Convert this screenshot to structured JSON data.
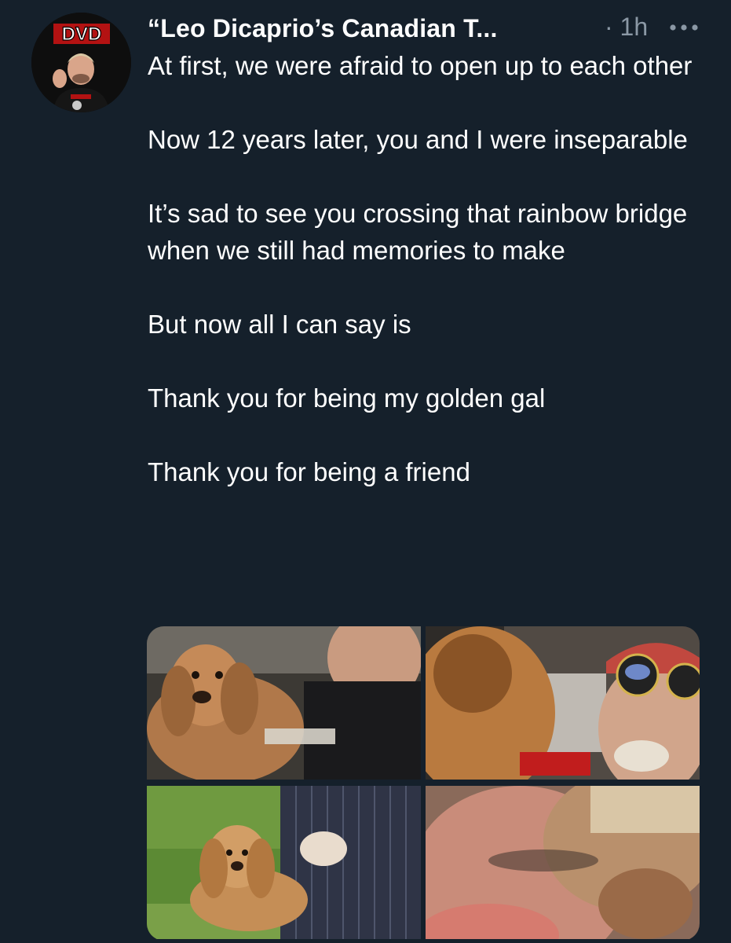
{
  "tweet": {
    "display_name": "“Leo Dicaprio’s Canadian T...",
    "timestamp": "· 1h",
    "body": "At first, we were afraid to open up to each other\n\nNow 12 years later, you and I were inseparable\n\nIt’s sad to see you crossing that rainbow bridge when we still had memories to make\n\nBut now all I can say is\n\nThank you for being my golden gal\n\nThank you for being a friend",
    "avatar_logo_text": "DVD"
  },
  "icons": {
    "more": "more-horizontal-icon"
  },
  "colors": {
    "background": "#15202b",
    "text": "#ffffff",
    "muted": "#8b98a5"
  }
}
